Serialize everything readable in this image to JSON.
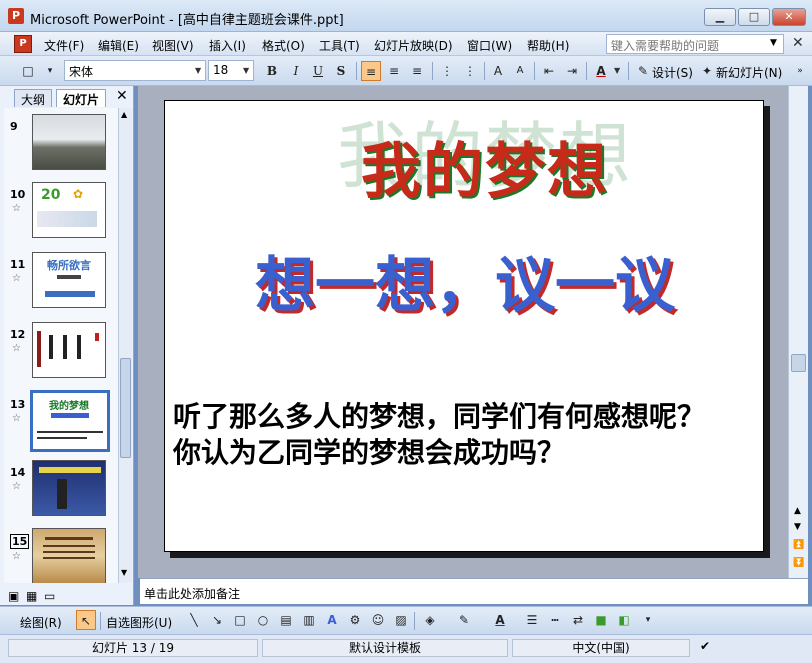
{
  "window": {
    "title": "Microsoft PowerPoint - [高中自律主题班会课件.ppt]",
    "app_icon": "P",
    "minimize": "▁",
    "maximize": "□",
    "close": "✕"
  },
  "menu": {
    "items": [
      "文件(F)",
      "编辑(E)",
      "视图(V)",
      "插入(I)",
      "格式(O)",
      "工具(T)",
      "幻灯片放映(D)",
      "窗口(W)",
      "帮助(H)"
    ],
    "help_placeholder": "键入需要帮助的问题",
    "close_glyph": "✕"
  },
  "format_toolbar": {
    "font": "宋体",
    "size": "18",
    "bold": "B",
    "italic": "I",
    "underline": "U",
    "shadow": "S",
    "design_label": "设计(S)",
    "new_slide_label": "新幻灯片(N)"
  },
  "left_panel": {
    "tabs": [
      "大纲",
      "幻灯片"
    ],
    "close_glyph": "✕",
    "slides": [
      {
        "num": "9",
        "has_star": false,
        "label": ""
      },
      {
        "num": "10",
        "has_star": true,
        "label": "20"
      },
      {
        "num": "11",
        "has_star": true,
        "label": "畅所欲言"
      },
      {
        "num": "12",
        "has_star": true,
        "label": ""
      },
      {
        "num": "13",
        "has_star": true,
        "label": "我的梦想",
        "selected": true
      },
      {
        "num": "14",
        "has_star": true,
        "label": ""
      },
      {
        "num": "15",
        "has_star": true,
        "label": ""
      }
    ]
  },
  "slide": {
    "watermark": "我的梦想",
    "title": "我的梦想",
    "subtitle": "想一想，议一议",
    "body": [
      "听了那么多人的梦想，同学们有何感想呢？",
      "你认为乙同学的梦想会成功吗？"
    ]
  },
  "notes_placeholder": "单击此处添加备注",
  "draw_toolbar": {
    "draw_label": "绘图(R)",
    "autoshapes_label": "自选图形(U)"
  },
  "status": {
    "slide_position": "幻灯片 13 / 19",
    "template": "默认设计模板",
    "language": "中文(中国)"
  },
  "icons": {
    "star": "☆"
  }
}
